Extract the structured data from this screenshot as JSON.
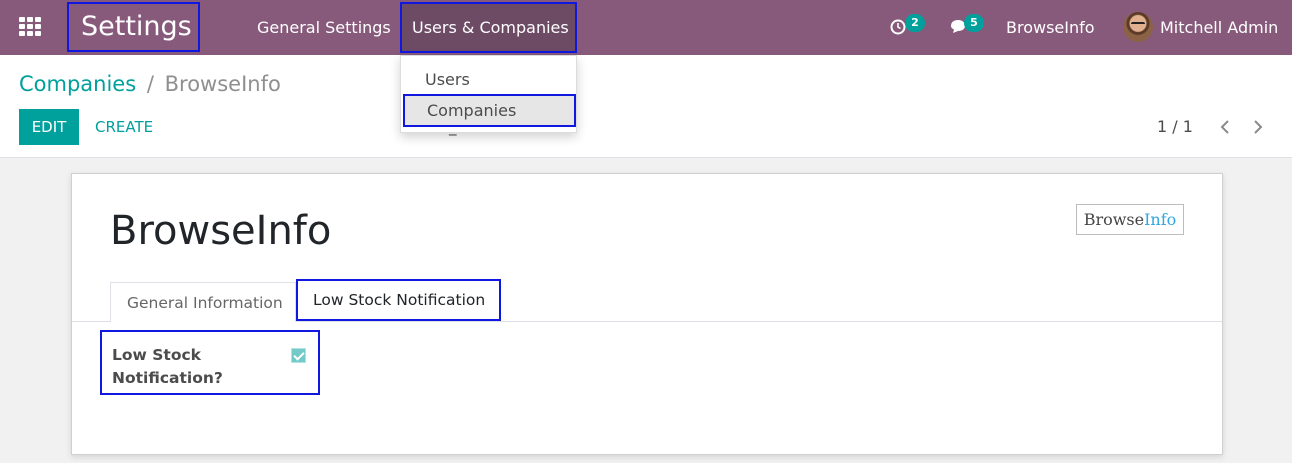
{
  "navbar": {
    "app_title": "Settings",
    "menu": [
      "General Settings",
      "Users & Companies"
    ],
    "activity_count": "2",
    "message_count": "5",
    "company": "BrowseInfo",
    "user": "Mitchell Admin"
  },
  "dropdown": {
    "items": [
      "Users",
      "Companies"
    ],
    "active": "Companies"
  },
  "breadcrumb": {
    "parent": "Companies",
    "separator": "/",
    "current": "BrowseInfo"
  },
  "toolbar": {
    "edit_label": "EDIT",
    "create_label": "CREATE",
    "action_text_visible": "_             on"
  },
  "pager": {
    "value": "1 / 1"
  },
  "form": {
    "record_name": "BrowseInfo",
    "logo": {
      "part1": "Browse",
      "part2": "Info"
    },
    "tabs": [
      "General Information",
      "Low Stock Notification"
    ],
    "active_tab": "Low Stock Notification",
    "field_label": "Low Stock Notification?",
    "field_checked": true
  },
  "colors": {
    "navbar": "#875a7b",
    "accent": "#00a09d",
    "highlight_border": "#1018e0"
  },
  "icons": [
    "apps-grid-icon",
    "activity-clock-icon",
    "chat-icon",
    "chevron-left-icon",
    "chevron-right-icon",
    "checkbox-checked-icon"
  ]
}
